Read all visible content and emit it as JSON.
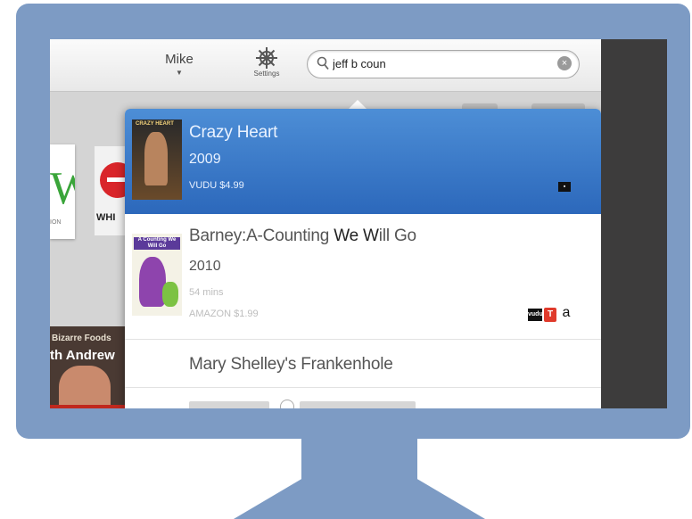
{
  "toolbar": {
    "user_name": "Mike",
    "settings_label": "Settings",
    "search_value": "jeff b coun"
  },
  "background_tiles": {
    "tile1_letter": "W",
    "tile1_sub": "ION",
    "tile2_text": "WHI",
    "show_line1": "Bizarre Foods",
    "show_line2": "th Andrew"
  },
  "results": [
    {
      "title": "Crazy Heart",
      "year": "2009",
      "price": "VUDU $4.99",
      "selected": true,
      "poster_text": "CRAZY HEART"
    },
    {
      "title_pre": "Barney:A-Counting ",
      "title_bold": "We W",
      "title_post": "ill Go",
      "year": "2010",
      "duration": "54 mins",
      "price": "AMAZON $1.99",
      "poster_text": "A Counting We Will Go",
      "sources": [
        "vudu",
        "T",
        "a"
      ]
    },
    {
      "title": "Mary Shelley's Frankenhole"
    }
  ],
  "colors": {
    "monitor": "#7d9bc4",
    "selected_row": "#2c68bb"
  }
}
